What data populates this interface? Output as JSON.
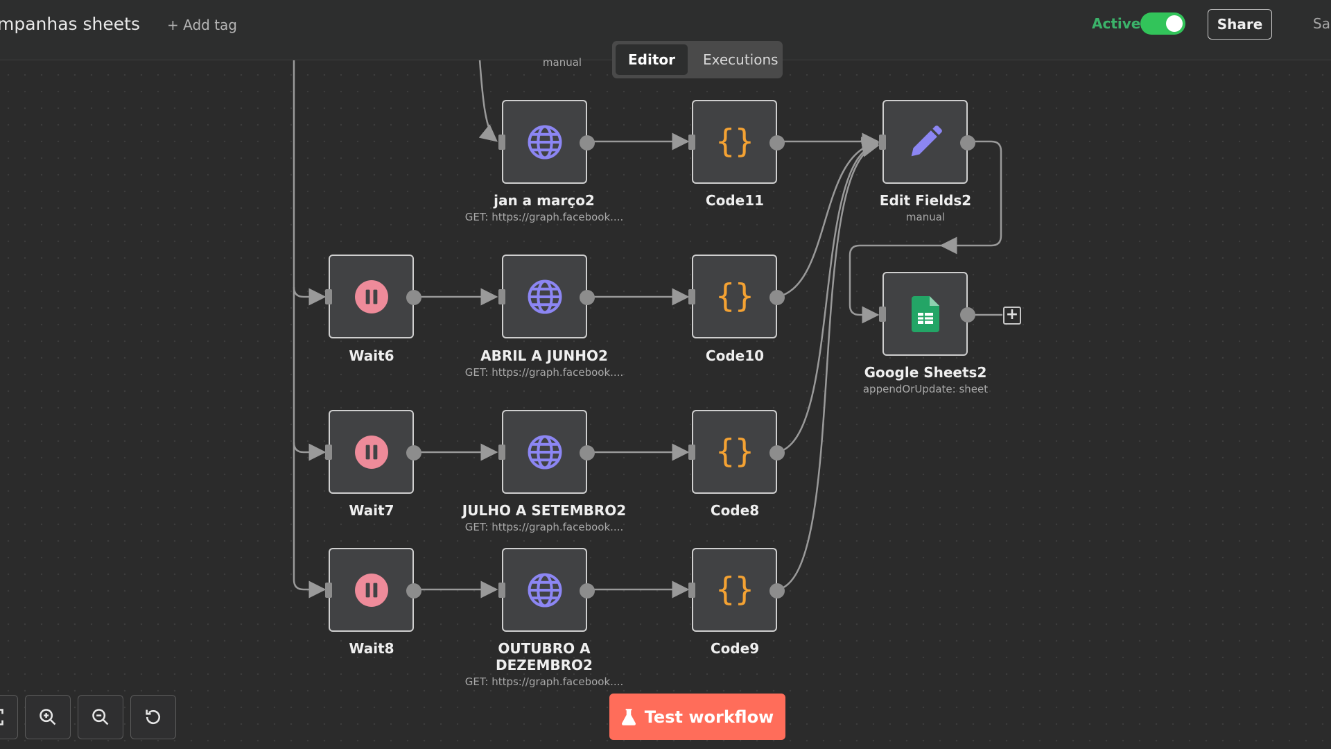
{
  "header": {
    "workflow_title": "mpanhas sheets",
    "add_tag_label": "+ Add tag",
    "active_label": "Active",
    "share_label": "Share",
    "save_label": "Sa"
  },
  "mode_switch": {
    "editor_label": "Editor",
    "executions_label": "Executions"
  },
  "canvas": {
    "top_partial_subtitle": "manual",
    "nodes": [
      {
        "id": "jan",
        "label": "jan a março2",
        "subtitle": "GET: https://graph.facebook....",
        "icon": "globe-icon"
      },
      {
        "id": "code11",
        "label": "Code11",
        "subtitle": "",
        "icon": "code-braces-icon"
      },
      {
        "id": "edit",
        "label": "Edit Fields2",
        "subtitle": "manual",
        "icon": "pencil-icon"
      },
      {
        "id": "wait6",
        "label": "Wait6",
        "subtitle": "",
        "icon": "pause-icon"
      },
      {
        "id": "abril",
        "label": "ABRIL A JUNHO2",
        "subtitle": "GET: https://graph.facebook....",
        "icon": "globe-icon"
      },
      {
        "id": "code10",
        "label": "Code10",
        "subtitle": "",
        "icon": "code-braces-icon"
      },
      {
        "id": "sheets",
        "label": "Google Sheets2",
        "subtitle": "appendOrUpdate: sheet",
        "icon": "google-sheets-icon"
      },
      {
        "id": "wait7",
        "label": "Wait7",
        "subtitle": "",
        "icon": "pause-icon"
      },
      {
        "id": "julho",
        "label": "JULHO A SETEMBRO2",
        "subtitle": "GET: https://graph.facebook....",
        "icon": "globe-icon"
      },
      {
        "id": "code8",
        "label": "Code8",
        "subtitle": "",
        "icon": "code-braces-icon"
      },
      {
        "id": "wait8",
        "label": "Wait8",
        "subtitle": "",
        "icon": "pause-icon"
      },
      {
        "id": "outubro",
        "label": "OUTUBRO A DEZEMBRO2",
        "subtitle": "GET: https://graph.facebook....",
        "icon": "globe-icon"
      },
      {
        "id": "code9",
        "label": "Code9",
        "subtitle": "",
        "icon": "code-braces-icon"
      }
    ]
  },
  "footer": {
    "test_workflow_label": "Test workflow",
    "zoom_controls": [
      "fit-view-icon",
      "zoom-in-icon",
      "zoom-out-icon",
      "reset-zoom-icon"
    ]
  },
  "colors": {
    "accent": "#ff6d5a",
    "active_green": "#32c45a",
    "globe": "#8c86f3",
    "code": "#f4a233",
    "pause": "#ee8b9a",
    "sheets": "#23a566"
  }
}
